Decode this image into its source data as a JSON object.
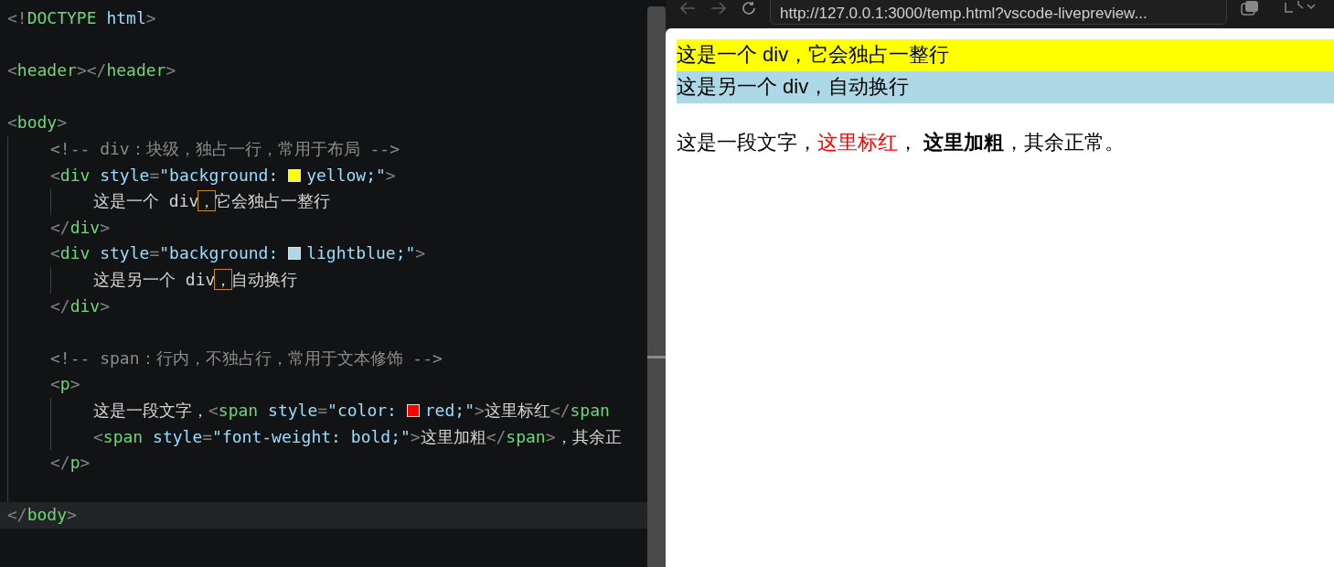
{
  "editor": {
    "lines": [
      {
        "kind": "code",
        "current": false,
        "tokens": [
          {
            "kind": "punct",
            "text": "<!"
          },
          {
            "kind": "tag",
            "text": "DOCTYPE"
          },
          {
            "kind": "attr",
            "text": " html"
          },
          {
            "kind": "punct",
            "text": ">"
          }
        ]
      },
      {
        "kind": "blank"
      },
      {
        "kind": "code",
        "current": false,
        "tokens": [
          {
            "kind": "punct",
            "text": "<"
          },
          {
            "kind": "tag",
            "text": "header"
          },
          {
            "kind": "punct",
            "text": "></"
          },
          {
            "kind": "tag",
            "text": "header"
          },
          {
            "kind": "punct",
            "text": ">"
          }
        ]
      },
      {
        "kind": "blank"
      },
      {
        "kind": "code",
        "current": false,
        "tokens": [
          {
            "kind": "punct",
            "text": "<"
          },
          {
            "kind": "tag",
            "text": "body"
          },
          {
            "kind": "punct",
            "text": ">"
          }
        ],
        "children": [
          {
            "kind": "code",
            "current": false,
            "tokens": [
              {
                "kind": "comment",
                "text": "<!-- div：块级，独占一行，常用于布局 -->"
              }
            ]
          },
          {
            "kind": "code",
            "current": false,
            "tokens": [
              {
                "kind": "punct",
                "text": "<"
              },
              {
                "kind": "tag",
                "text": "div"
              },
              {
                "kind": "attr",
                "text": " style"
              },
              {
                "kind": "punct",
                "text": "="
              },
              {
                "kind": "string",
                "text": "\"background: "
              },
              {
                "kind": "swatch",
                "color": "#ffff00"
              },
              {
                "kind": "string",
                "text": "yellow;\""
              },
              {
                "kind": "punct",
                "text": ">"
              }
            ],
            "children": [
              {
                "kind": "code",
                "current": false,
                "tokens": [
                  {
                    "kind": "text",
                    "text": "这是一个 div"
                  },
                  {
                    "kind": "flagged",
                    "text": "，"
                  },
                  {
                    "kind": "text",
                    "text": "它会独占一整行"
                  }
                ]
              }
            ]
          },
          {
            "kind": "code",
            "current": false,
            "tokens": [
              {
                "kind": "punct",
                "text": "</"
              },
              {
                "kind": "tag",
                "text": "div"
              },
              {
                "kind": "punct",
                "text": ">"
              }
            ]
          },
          {
            "kind": "code",
            "current": false,
            "tokens": [
              {
                "kind": "punct",
                "text": "<"
              },
              {
                "kind": "tag",
                "text": "div"
              },
              {
                "kind": "attr",
                "text": " style"
              },
              {
                "kind": "punct",
                "text": "="
              },
              {
                "kind": "string",
                "text": "\"background: "
              },
              {
                "kind": "swatch",
                "color": "#add8e6"
              },
              {
                "kind": "string",
                "text": "lightblue;\""
              },
              {
                "kind": "punct",
                "text": ">"
              }
            ],
            "children": [
              {
                "kind": "code",
                "current": false,
                "tokens": [
                  {
                    "kind": "text",
                    "text": "这是另一个 div"
                  },
                  {
                    "kind": "flagged",
                    "text": "，"
                  },
                  {
                    "kind": "text",
                    "text": "自动换行"
                  }
                ]
              }
            ]
          },
          {
            "kind": "code",
            "current": false,
            "tokens": [
              {
                "kind": "punct",
                "text": "</"
              },
              {
                "kind": "tag",
                "text": "div"
              },
              {
                "kind": "punct",
                "text": ">"
              }
            ]
          },
          {
            "kind": "blank"
          },
          {
            "kind": "code",
            "current": false,
            "tokens": [
              {
                "kind": "comment",
                "text": "<!-- span：行内，不独占行，常用于文本修饰 -->"
              }
            ]
          },
          {
            "kind": "code",
            "current": false,
            "tokens": [
              {
                "kind": "punct",
                "text": "<"
              },
              {
                "kind": "tag",
                "text": "p"
              },
              {
                "kind": "punct",
                "text": ">"
              }
            ],
            "children": [
              {
                "kind": "code",
                "current": false,
                "tokens": [
                  {
                    "kind": "text",
                    "text": "这是一段文字，"
                  },
                  {
                    "kind": "punct",
                    "text": "<"
                  },
                  {
                    "kind": "tag",
                    "text": "span"
                  },
                  {
                    "kind": "attr",
                    "text": " style"
                  },
                  {
                    "kind": "punct",
                    "text": "="
                  },
                  {
                    "kind": "string",
                    "text": "\"color: "
                  },
                  {
                    "kind": "swatch",
                    "color": "#ff0000"
                  },
                  {
                    "kind": "string",
                    "text": "red;\""
                  },
                  {
                    "kind": "punct",
                    "text": ">"
                  },
                  {
                    "kind": "text",
                    "text": "这里标红"
                  },
                  {
                    "kind": "punct",
                    "text": "</"
                  },
                  {
                    "kind": "tag",
                    "text": "span"
                  }
                ]
              },
              {
                "kind": "code",
                "current": false,
                "tokens": [
                  {
                    "kind": "punct",
                    "text": "<"
                  },
                  {
                    "kind": "tag",
                    "text": "span"
                  },
                  {
                    "kind": "attr",
                    "text": " style"
                  },
                  {
                    "kind": "punct",
                    "text": "="
                  },
                  {
                    "kind": "string",
                    "text": "\"font-weight: bold;\""
                  },
                  {
                    "kind": "punct",
                    "text": ">"
                  },
                  {
                    "kind": "text",
                    "text": "这里加粗"
                  },
                  {
                    "kind": "punct",
                    "text": "</"
                  },
                  {
                    "kind": "tag",
                    "text": "span"
                  },
                  {
                    "kind": "punct",
                    "text": ">"
                  },
                  {
                    "kind": "text",
                    "text": "，其余正"
                  }
                ]
              }
            ]
          },
          {
            "kind": "code",
            "current": false,
            "tokens": [
              {
                "kind": "punct",
                "text": "</"
              },
              {
                "kind": "tag",
                "text": "p"
              },
              {
                "kind": "punct",
                "text": ">"
              }
            ]
          },
          {
            "kind": "blank"
          }
        ]
      },
      {
        "kind": "code",
        "current": true,
        "tokens": [
          {
            "kind": "punct",
            "text": "</"
          },
          {
            "kind": "tag",
            "text": "body"
          },
          {
            "kind": "punct",
            "text": ">"
          }
        ]
      }
    ]
  },
  "browser": {
    "url": "http://127.0.0.1:3000/temp.html?vscode-livepreview...",
    "blocks": [
      {
        "kind": "div",
        "color": "#ffff00",
        "text": "这是一个 div，它会独占一整行"
      },
      {
        "kind": "div",
        "color": "#add8e6",
        "text": "这是另一个 div，自动换行"
      },
      {
        "kind": "paragraph",
        "parts": [
          {
            "kind": "plain",
            "text": "这是一段文字，"
          },
          {
            "kind": "red",
            "text": "这里标红"
          },
          {
            "kind": "plain",
            "text": "， "
          },
          {
            "kind": "bold",
            "text": "这里加粗"
          },
          {
            "kind": "plain",
            "text": "，其余正常。"
          }
        ]
      }
    ]
  }
}
